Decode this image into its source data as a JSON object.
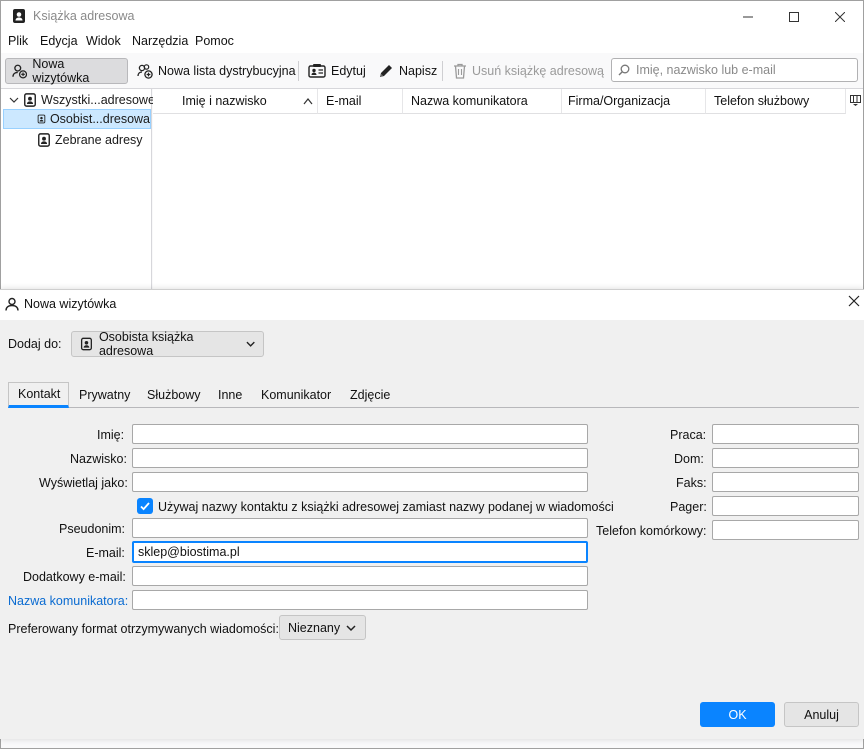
{
  "window": {
    "title": "Książka adresowa",
    "controls": [
      "minimize",
      "maximize",
      "close"
    ]
  },
  "menu": [
    "Plik",
    "Edycja",
    "Widok",
    "Narzędzia",
    "Pomoc"
  ],
  "toolbar": {
    "new_card": "Nowa wizytówka",
    "new_list": "Nowa lista dystrybucyjna",
    "edit": "Edytuj",
    "write": "Napisz",
    "delete_book": "Usuń książkę adresową",
    "search_placeholder": "Imię, nazwisko lub e-mail"
  },
  "tree": {
    "items": [
      {
        "label": "Wszystki...adresowe",
        "expanded": true,
        "selected": false
      },
      {
        "label": "Osobist...dresowa",
        "selected": true
      },
      {
        "label": "Zebrane adresy",
        "selected": false
      }
    ]
  },
  "columns": [
    "Imię i nazwisko",
    "E-mail",
    "Nazwa komunikatora",
    "Firma/Organizacja",
    "Telefon służbowy"
  ],
  "dialog": {
    "title": "Nowa wizytówka",
    "add_to_label": "Dodaj do:",
    "add_to_value": "Osobista książka adresowa",
    "tabs": [
      "Kontakt",
      "Prywatny",
      "Służbowy",
      "Inne",
      "Komunikator",
      "Zdjęcie"
    ],
    "active_tab": "Kontakt",
    "fields": {
      "first_name": {
        "label": "Imię:",
        "value": ""
      },
      "last_name": {
        "label": "Nazwisko:",
        "value": ""
      },
      "display_name": {
        "label": "Wyświetlaj jako:",
        "value": ""
      },
      "use_display_name": {
        "label": "Używaj nazwy kontaktu z książki adresowej zamiast nazwy podanej w wiadomości",
        "checked": true
      },
      "nickname": {
        "label": "Pseudonim:",
        "value": ""
      },
      "email": {
        "label": "E-mail:",
        "value": "sklep@biostima.pl"
      },
      "additional_email": {
        "label": "Dodatkowy e-mail:",
        "value": ""
      },
      "im_name": {
        "label": "Nazwa komunikatora:",
        "value": ""
      },
      "work_phone": {
        "label": "Praca:",
        "value": ""
      },
      "home_phone": {
        "label": "Dom:",
        "value": ""
      },
      "fax": {
        "label": "Faks:",
        "value": ""
      },
      "pager": {
        "label": "Pager:",
        "value": ""
      },
      "mobile": {
        "label": "Telefon komórkowy:",
        "value": ""
      }
    },
    "format_label": "Preferowany format otrzymywanych wiadomości:",
    "format_value": "Nieznany",
    "ok": "OK",
    "cancel": "Anuluj"
  },
  "colors": {
    "accent": "#0a84ff",
    "selection": "#cce8ff",
    "link_label": "#0a6bd1"
  }
}
